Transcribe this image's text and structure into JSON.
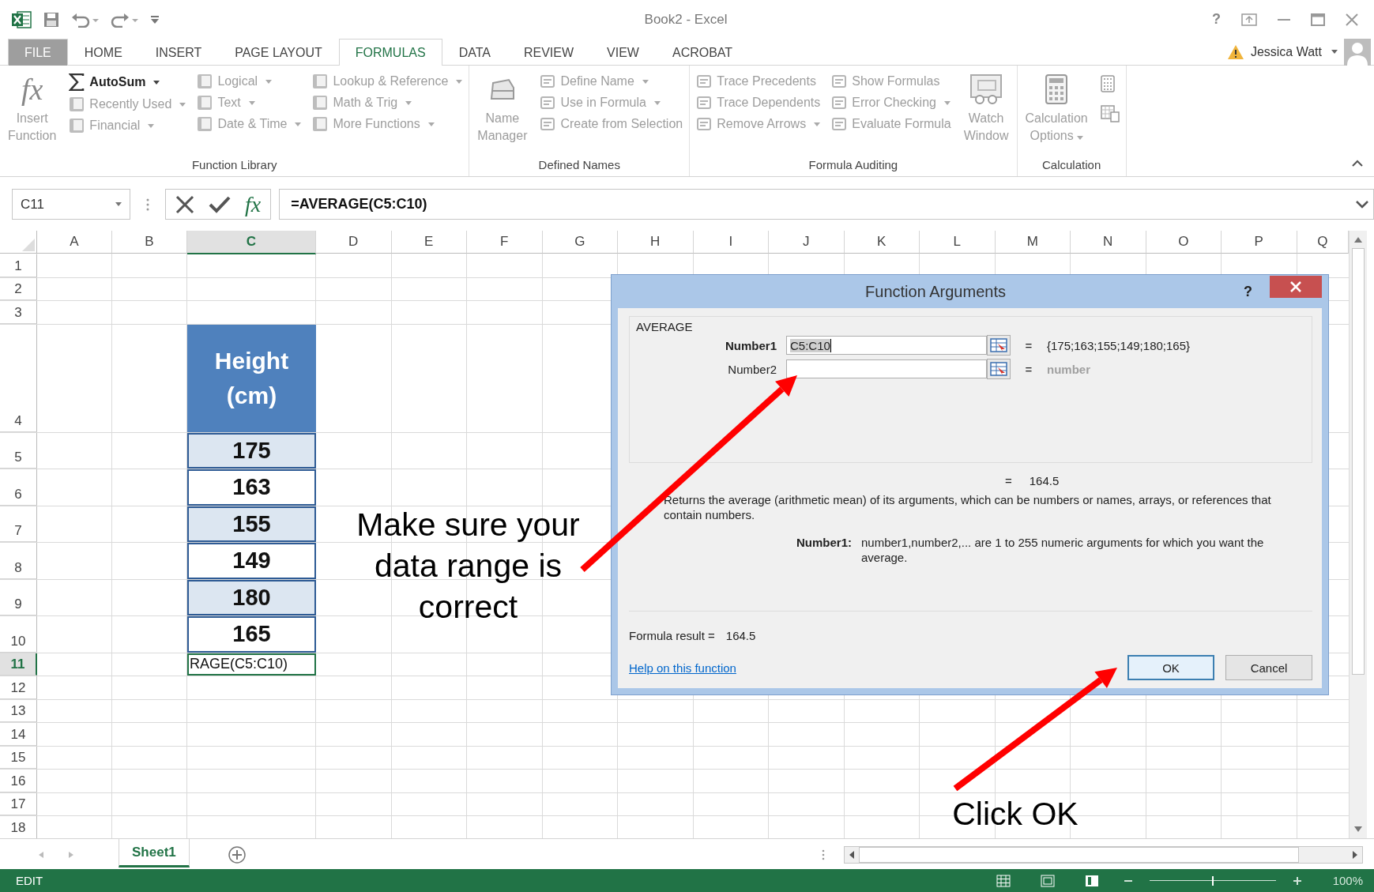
{
  "title_bar": {
    "title": "Book2 - Excel",
    "help": "?"
  },
  "tabs": [
    {
      "label": "FILE",
      "selected": false,
      "disabled": true
    },
    {
      "label": "HOME",
      "selected": false,
      "disabled": false
    },
    {
      "label": "INSERT",
      "selected": false,
      "disabled": false
    },
    {
      "label": "PAGE LAYOUT",
      "selected": false,
      "disabled": false
    },
    {
      "label": "FORMULAS",
      "selected": true,
      "disabled": false
    },
    {
      "label": "DATA",
      "selected": false,
      "disabled": false
    },
    {
      "label": "REVIEW",
      "selected": false,
      "disabled": false
    },
    {
      "label": "VIEW",
      "selected": false,
      "disabled": false
    },
    {
      "label": "ACROBAT",
      "selected": false,
      "disabled": false
    }
  ],
  "user": {
    "name": "Jessica Watt",
    "warning": true
  },
  "ribbon": {
    "groups": [
      {
        "label": "Function Library",
        "controls": [
          {
            "kind": "large",
            "label": "Insert Function",
            "glyph": "fx",
            "disabled": true,
            "has_menu": false
          },
          {
            "kind": "stack",
            "items": [
              {
                "label": "AutoSum",
                "disabled": false,
                "has_menu": true
              },
              {
                "label": "Recently Used",
                "disabled": true,
                "has_menu": true
              },
              {
                "label": "Financial",
                "disabled": true,
                "has_menu": true
              }
            ]
          },
          {
            "kind": "stack",
            "items": [
              {
                "label": "Logical",
                "disabled": true,
                "has_menu": true
              },
              {
                "label": "Text",
                "disabled": true,
                "has_menu": true
              },
              {
                "label": "Date & Time",
                "disabled": true,
                "has_menu": true
              }
            ]
          },
          {
            "kind": "stack",
            "items": [
              {
                "label": "Lookup & Reference",
                "disabled": true,
                "has_menu": true
              },
              {
                "label": "Math & Trig",
                "disabled": true,
                "has_menu": true
              },
              {
                "label": "More Functions",
                "disabled": true,
                "has_menu": true
              }
            ]
          }
        ]
      },
      {
        "label": "Defined Names",
        "controls": [
          {
            "kind": "large",
            "label": "Name Manager",
            "disabled": true,
            "has_menu": false
          },
          {
            "kind": "stack",
            "items": [
              {
                "label": "Define Name",
                "disabled": true,
                "has_menu": true
              },
              {
                "label": "Use in Formula",
                "disabled": true,
                "has_menu": true
              },
              {
                "label": "Create from Selection",
                "disabled": true,
                "has_menu": false
              }
            ]
          }
        ]
      },
      {
        "label": "Formula Auditing",
        "controls": [
          {
            "kind": "stack",
            "items": [
              {
                "label": "Trace Precedents",
                "disabled": true,
                "has_menu": false
              },
              {
                "label": "Trace Dependents",
                "disabled": true,
                "has_menu": false
              },
              {
                "label": "Remove Arrows",
                "disabled": true,
                "has_menu": true
              }
            ]
          },
          {
            "kind": "stack",
            "items": [
              {
                "label": "Show Formulas",
                "disabled": true,
                "has_menu": false
              },
              {
                "label": "Error Checking",
                "disabled": true,
                "has_menu": true
              },
              {
                "label": "Evaluate Formula",
                "disabled": true,
                "has_menu": false
              }
            ]
          },
          {
            "kind": "large",
            "label": "Watch Window",
            "disabled": true,
            "has_menu": false
          }
        ]
      },
      {
        "label": "Calculation",
        "controls": [
          {
            "kind": "large",
            "label": "Calculation Options",
            "disabled": true,
            "has_menu": true
          },
          {
            "kind": "icons"
          }
        ]
      }
    ]
  },
  "formula_bar": {
    "name_box": "C11",
    "fx": "fx",
    "formula": "=AVERAGE(C5:C10)"
  },
  "columns": [
    {
      "label": "A",
      "selected": false
    },
    {
      "label": "B",
      "selected": false
    },
    {
      "label": "C",
      "selected": true
    },
    {
      "label": "D",
      "selected": false
    },
    {
      "label": "E",
      "selected": false
    },
    {
      "label": "F",
      "selected": false
    },
    {
      "label": "G",
      "selected": false
    },
    {
      "label": "H",
      "selected": false
    },
    {
      "label": "I",
      "selected": false
    },
    {
      "label": "J",
      "selected": false
    },
    {
      "label": "K",
      "selected": false
    },
    {
      "label": "L",
      "selected": false
    },
    {
      "label": "M",
      "selected": false
    },
    {
      "label": "N",
      "selected": false
    },
    {
      "label": "O",
      "selected": false
    },
    {
      "label": "P",
      "selected": false
    },
    {
      "label": "Q",
      "selected": false
    }
  ],
  "rows": [
    {
      "number": "1",
      "selected": false
    },
    {
      "number": "2",
      "selected": false
    },
    {
      "number": "3",
      "selected": false
    },
    {
      "number": "4",
      "selected": false,
      "cell": {
        "kind": "header",
        "text": "Height (cm)"
      }
    },
    {
      "number": "5",
      "selected": false,
      "cell": {
        "kind": "value",
        "text": "175",
        "shaded": true
      }
    },
    {
      "number": "6",
      "selected": false,
      "cell": {
        "kind": "value",
        "text": "163",
        "shaded": false
      }
    },
    {
      "number": "7",
      "selected": false,
      "cell": {
        "kind": "value",
        "text": "155",
        "shaded": true
      }
    },
    {
      "number": "8",
      "selected": false,
      "cell": {
        "kind": "value",
        "text": "149",
        "shaded": false
      }
    },
    {
      "number": "9",
      "selected": false,
      "cell": {
        "kind": "value",
        "text": "180",
        "shaded": true
      }
    },
    {
      "number": "10",
      "selected": false,
      "cell": {
        "kind": "value",
        "text": "165",
        "shaded": false
      }
    },
    {
      "number": "11",
      "selected": true,
      "cell": {
        "kind": "editing",
        "text": "RAGE(C5:C10)"
      }
    },
    {
      "number": "12",
      "selected": false
    },
    {
      "number": "13",
      "selected": false
    },
    {
      "number": "14",
      "selected": false
    },
    {
      "number": "15",
      "selected": false
    },
    {
      "number": "16",
      "selected": false
    },
    {
      "number": "17",
      "selected": false
    },
    {
      "number": "18",
      "selected": false
    }
  ],
  "dialog": {
    "title": "Function Arguments",
    "help": "?",
    "function": "AVERAGE",
    "arguments": [
      {
        "label": "Number1",
        "required": true,
        "value": "C5:C10",
        "value_selected": true,
        "result": "{175;163;155;149;180;165}",
        "result_muted": false
      },
      {
        "label": "Number2",
        "required": false,
        "result": "number",
        "result_muted": true
      }
    ],
    "equals": "=",
    "result": "164.5",
    "description": "Returns the average (arithmetic mean) of its arguments, which can be numbers or names, arrays, or references that contain numbers.",
    "argument_help_label": "Number1:",
    "argument_help": "number1,number2,... are 1 to 255 numeric arguments for which you want the average.",
    "formula_result_label": "Formula result =",
    "formula_result": "164.5",
    "help_link": "Help on this function",
    "buttons": [
      {
        "label": "OK",
        "focused": true
      },
      {
        "label": "Cancel",
        "focused": false
      }
    ]
  },
  "annotations": [
    {
      "text": "Make sure your data range is correct"
    },
    {
      "text": "Click OK"
    }
  ],
  "sheet_tabs": [
    {
      "label": "Sheet1",
      "selected": true
    }
  ],
  "status_bar": {
    "mode": "EDIT",
    "zoom": {
      "level": 0.5,
      "reading": "100%"
    }
  }
}
